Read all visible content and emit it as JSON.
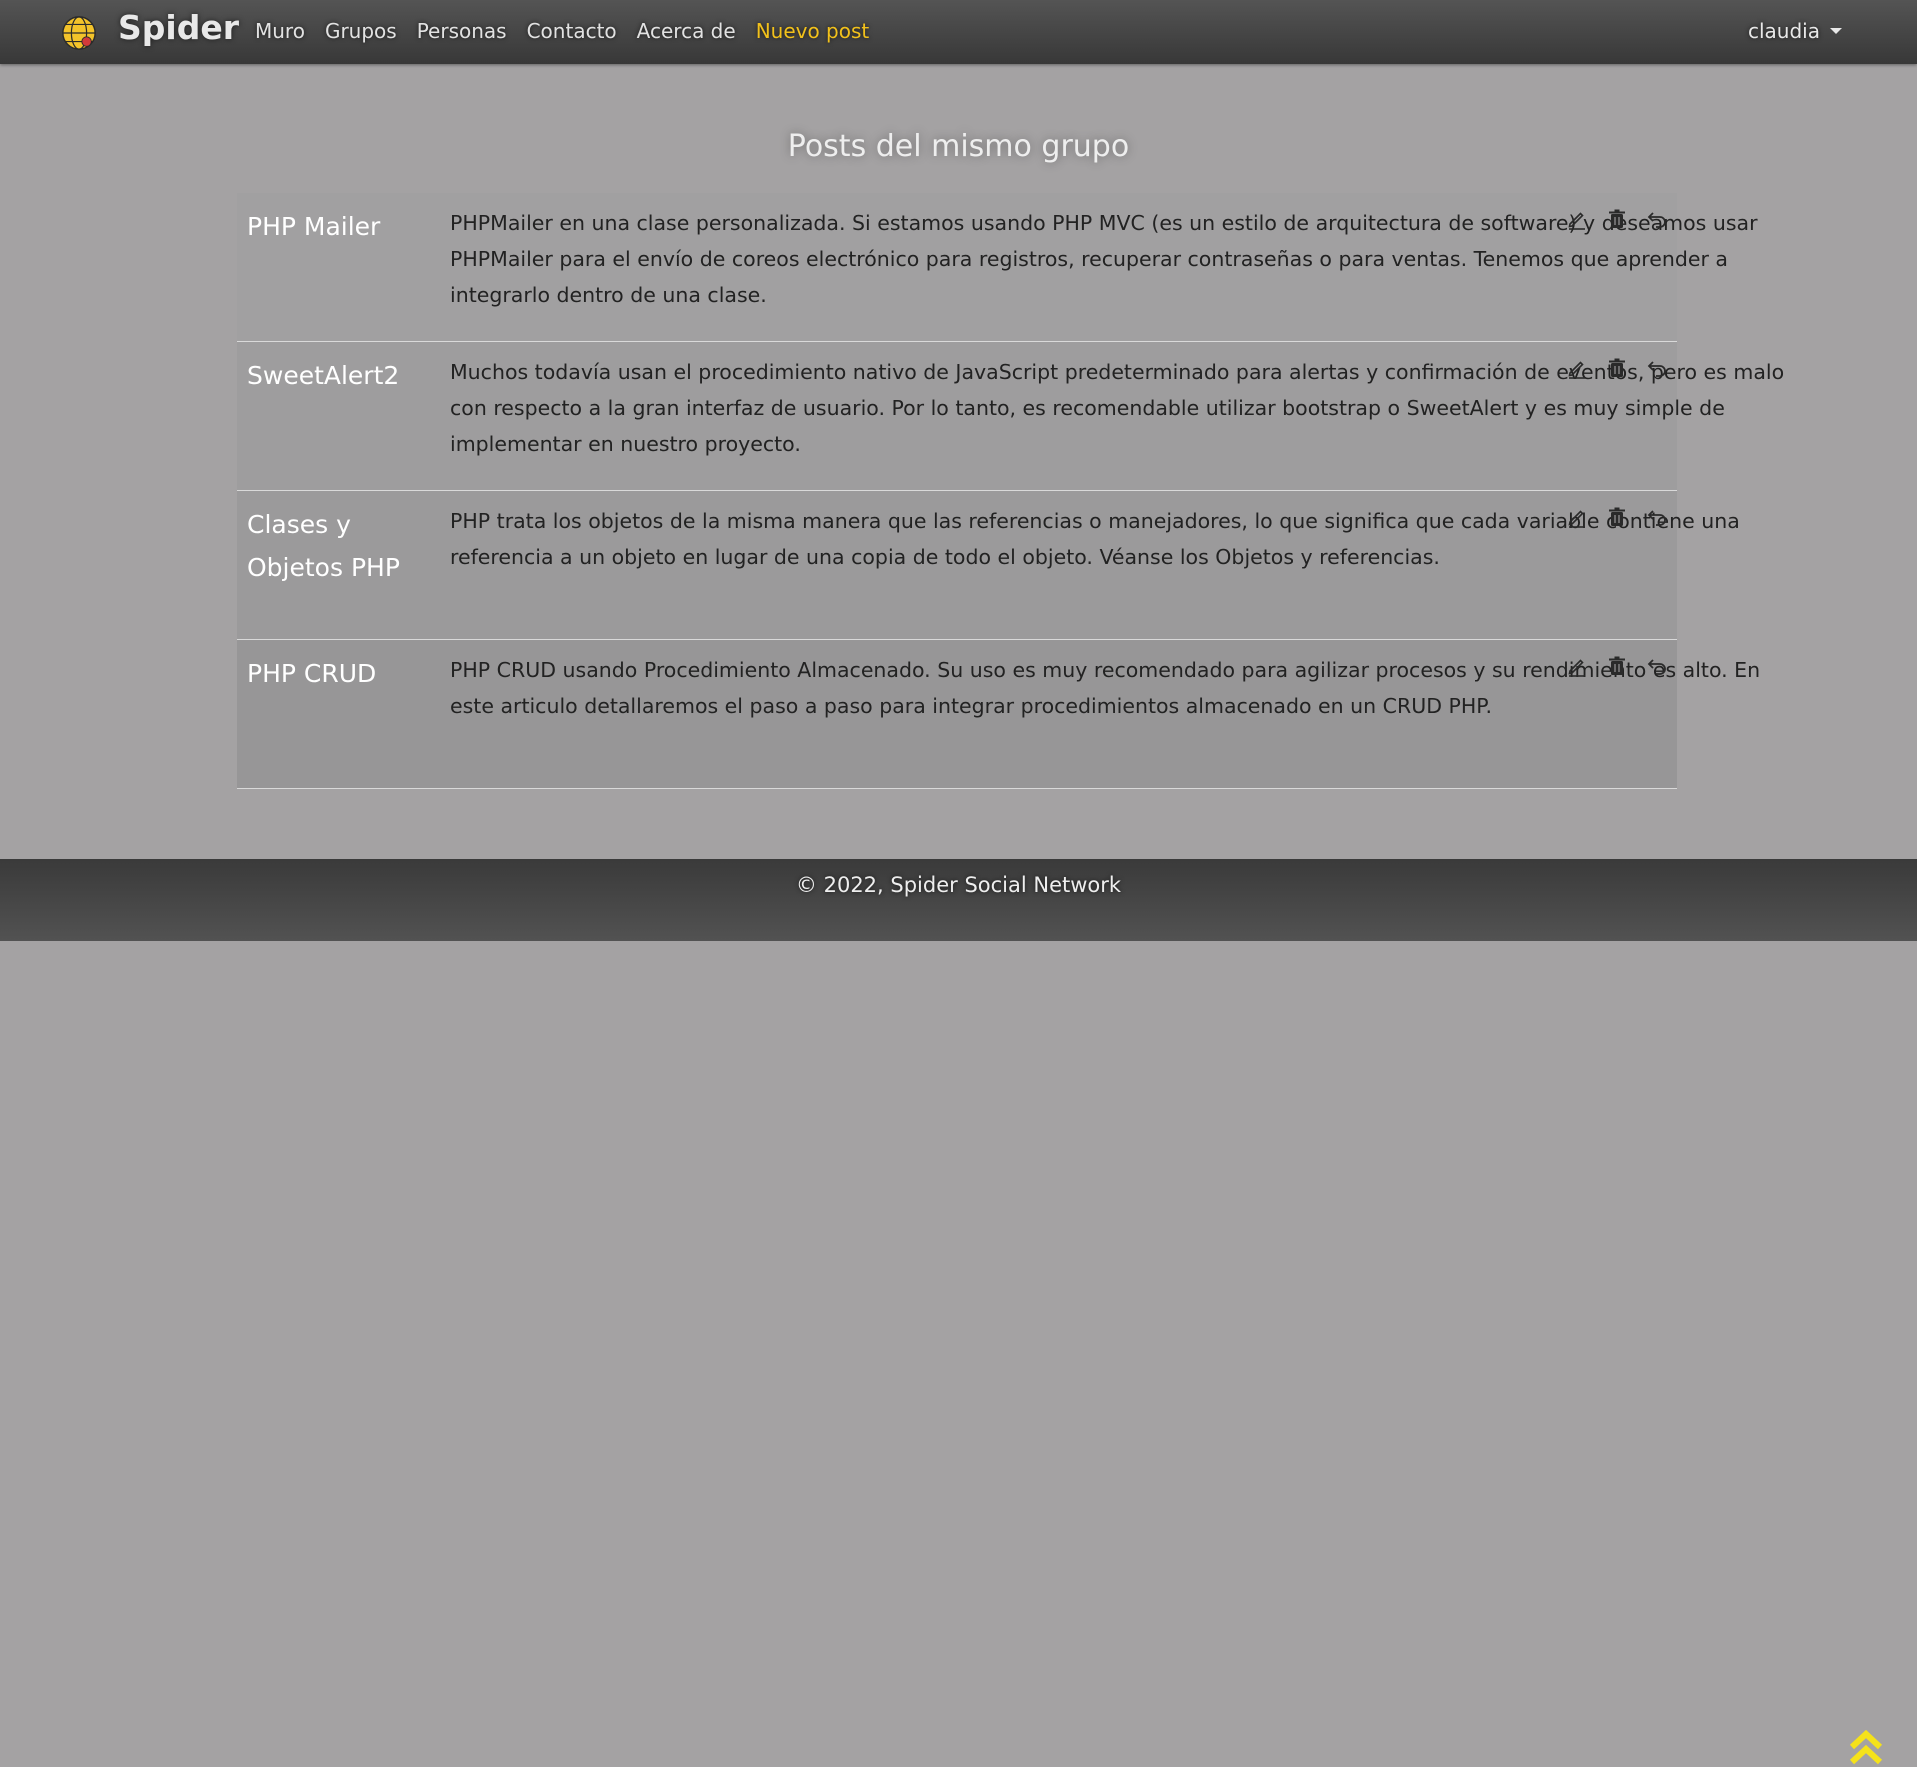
{
  "navbar": {
    "brand": "Spider",
    "links": [
      {
        "label": "Muro"
      },
      {
        "label": "Grupos"
      },
      {
        "label": "Personas"
      },
      {
        "label": "Contacto"
      },
      {
        "label": "Acerca de"
      },
      {
        "label": "Nuevo post"
      }
    ],
    "user": "claudia"
  },
  "page": {
    "title": "Posts del mismo grupo"
  },
  "posts": [
    {
      "title": "PHP Mailer",
      "body": "PHPMailer en una clase personalizada. Si estamos usando PHP MVC (es un estilo de arquitectura de software) y deseamos usar PHPMailer para el envío de coreos electrónico para registros, recuperar contraseñas o para ventas. Tenemos que aprender a integrarlo dentro de una clase."
    },
    {
      "title": "SweetAlert2",
      "body": "Muchos todavía usan el procedimiento nativo de JavaScript predeterminado para alertas y confirmación de eventos, pero es malo con respecto a la gran interfaz de usuario. Por lo tanto, es recomendable utilizar bootstrap o SweetAlert y es muy simple de implementar en nuestro proyecto."
    },
    {
      "title": "Clases y Objetos PHP",
      "body": "PHP trata los objetos de la misma manera que las referencias o manejadores, lo que significa que cada variable contiene una referencia a un objeto en lugar de una copia de todo el objeto. Véanse los Objetos y referencias."
    },
    {
      "title": "PHP CRUD",
      "body": "PHP CRUD usando Procedimiento Almacenado. Su uso es muy recomendado para agilizar procesos y su rendimiento es alto. En este articulo detallaremos el paso a paso para integrar procedimientos almacenado en un CRUD PHP."
    }
  ],
  "footer": {
    "text": "© 2022, Spider Social Network"
  },
  "icons": {
    "edit": "pencil-icon",
    "delete": "trash-icon",
    "back": "undo-icon",
    "scroll_top": "double-chevron-up-icon"
  },
  "colors": {
    "accent": "#f2c11b",
    "background": "#a4a2a3",
    "navbar": "#454545"
  }
}
